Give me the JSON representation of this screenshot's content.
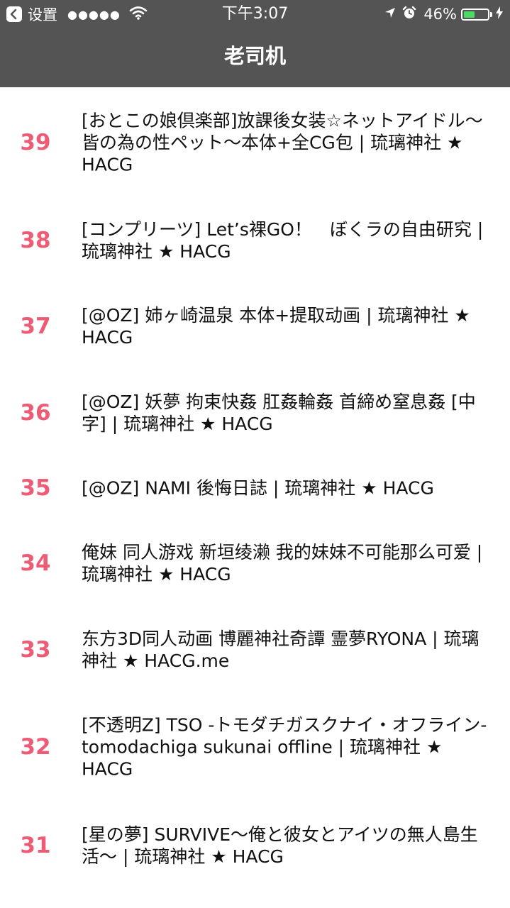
{
  "status_bar": {
    "back_app": "设置",
    "signal": "●●●●●",
    "time": "下午3:07",
    "battery": "46%",
    "battery_level": 0.46,
    "battery_color": "#4cd964"
  },
  "nav": {
    "title": "老司机",
    "background": "#545454"
  },
  "accent_color": "#ee5b74",
  "items": [
    {
      "number": "39",
      "title": "[おとこの娘倶楽部]放課後女装☆ネットアイドル～皆の為の性ペット～本体+全CG包 | 琉璃神社 ★ HACG"
    },
    {
      "number": "38",
      "title": "[コンプリーツ] Let’s裸GO！　ぼくラの自由研究 | 琉璃神社 ★ HACG"
    },
    {
      "number": "37",
      "title": "[@OZ] 姉ヶ崎温泉 本体+提取动画 | 琉璃神社 ★ HACG"
    },
    {
      "number": "36",
      "title": "[@OZ] 妖夢 拘束快姦 肛姦輪姦 首締め窒息姦 [中字] | 琉璃神社 ★ HACG"
    },
    {
      "number": "35",
      "title": "[@OZ] NAMI 後悔日誌 | 琉璃神社 ★ HACG"
    },
    {
      "number": "34",
      "title": "俺妹 同人游戏 新垣绫濑 我的妹妹不可能那么可爱 | 琉璃神社 ★ HACG"
    },
    {
      "number": "33",
      "title": "东方3D同人动画 博麗神社奇譚 霊夢RYONA | 琉璃神社 ★ HACG.me"
    },
    {
      "number": "32",
      "title": "[不透明Z] TSO -トモダチガスクナイ・オフライン- tomodachiga sukunai offline | 琉璃神社 ★ HACG"
    },
    {
      "number": "31",
      "title": "[星の夢] SURVIVE～俺と彼女とアイツの無人島生活～ | 琉璃神社 ★ HACG"
    }
  ]
}
